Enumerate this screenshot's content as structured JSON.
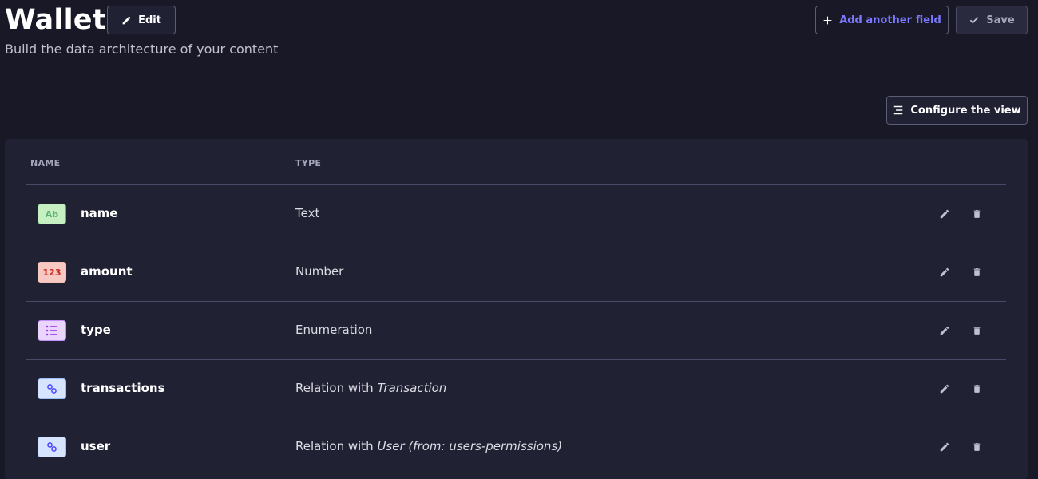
{
  "header": {
    "title": "Wallet",
    "subtitle": "Build the data architecture of your content",
    "edit_label": "Edit",
    "add_field_label": "Add another field",
    "save_label": "Save",
    "configure_label": "Configure the view"
  },
  "table": {
    "columns": [
      "NAME",
      "TYPE"
    ],
    "rows": [
      {
        "badge": "Ab",
        "icon": "text-type-icon",
        "name": "name",
        "type": "Text",
        "type_target": ""
      },
      {
        "badge": "123",
        "icon": "number-type-icon",
        "name": "amount",
        "type": "Number",
        "type_target": ""
      },
      {
        "badge": "",
        "icon": "enumeration-list-icon",
        "name": "type",
        "type": "Enumeration",
        "type_target": ""
      },
      {
        "badge": "",
        "icon": "relation-link-icon",
        "name": "transactions",
        "type": "Relation with",
        "type_target": "Transaction"
      },
      {
        "badge": "",
        "icon": "relation-link-icon",
        "name": "user",
        "type": "Relation with",
        "type_target": "User (from: users-permissions)"
      }
    ]
  },
  "colors": {
    "background": "#181826",
    "card": "#212134",
    "accent": "#7b79ff",
    "border": "#4a4a6a"
  }
}
